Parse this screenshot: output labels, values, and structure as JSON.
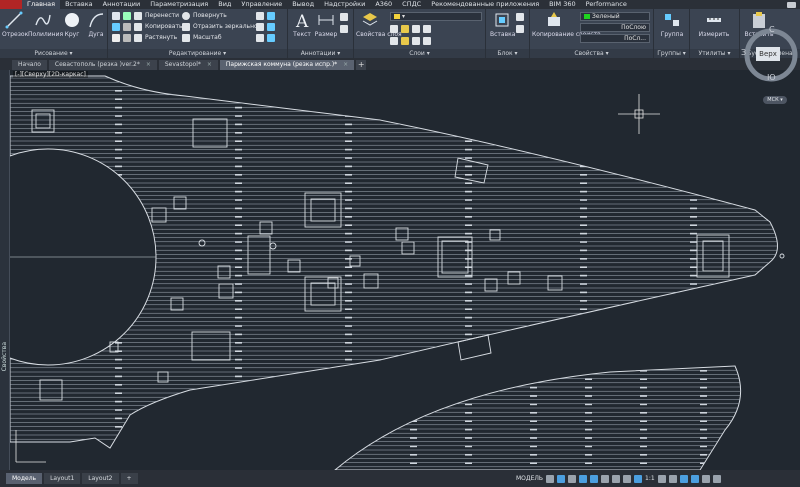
{
  "ribbon_tabs": [
    "Главная",
    "Вставка",
    "Аннотации",
    "Параметризация",
    "Вид",
    "Управление",
    "Вывод",
    "Надстройки",
    "А360",
    "СПДС",
    "Рекомендованные приложения",
    "BIM 360",
    "Performance"
  ],
  "active_tab": "Главная",
  "panels": {
    "draw": {
      "title": "Рисование ▾",
      "line": "Отрезок",
      "polyline": "Полилиния",
      "circle": "Круг",
      "arc": "Дуга"
    },
    "modify": {
      "title": "Редактирование ▾",
      "move": "Перенести",
      "rotate": "Повернуть",
      "copy": "Копировать",
      "mirror": "Отразить зеркально",
      "stretch": "Растянуть",
      "scale": "Масштаб"
    },
    "annotation": {
      "title": "Аннотации ▾",
      "text": "Текст",
      "dimension": "Размер"
    },
    "layers": {
      "title": "Слои ▾",
      "layer_props": "Свойства слоя"
    },
    "block": {
      "title": "Блок ▾",
      "insert": "Вставка"
    },
    "properties": {
      "title": "Свойства ▾",
      "match": "Копирование свойств",
      "color": "Зеленый",
      "linetype": "ПоСлою",
      "lineweight": "ПоСл..."
    },
    "groups": {
      "title": "Группы ▾",
      "group": "Группа"
    },
    "utilities": {
      "title": "Утилиты ▾",
      "measure": "Измерить"
    },
    "clipboard": {
      "title": "Буфер обмена",
      "paste": "Вставить"
    }
  },
  "file_tabs": [
    {
      "label": "Начало",
      "active": false
    },
    {
      "label": "Севастополь (резка )ver.2*",
      "active": false
    },
    {
      "label": "Sevastopol*",
      "active": false
    },
    {
      "label": "Парижская коммуна (резка испр.)*",
      "active": true
    }
  ],
  "viewport_label": "[-][Сверху][2D-каркас]",
  "side_palette_label": "Свойства",
  "viewcube": {
    "top": "С",
    "bottom": "Ю",
    "left": "З",
    "face": "Верх",
    "wcs": "МСК ▾"
  },
  "layout_tabs": [
    {
      "label": "Модель",
      "active": true
    },
    {
      "label": "Layout1",
      "active": false
    },
    {
      "label": "Layout2",
      "active": false
    }
  ],
  "status": {
    "model": "МОДЕЛЬ",
    "scale": "1:1"
  },
  "colors": {
    "accent_red": "#b12525",
    "drawing_line": "#d8dde3",
    "layer_green": "#1fd41f"
  }
}
